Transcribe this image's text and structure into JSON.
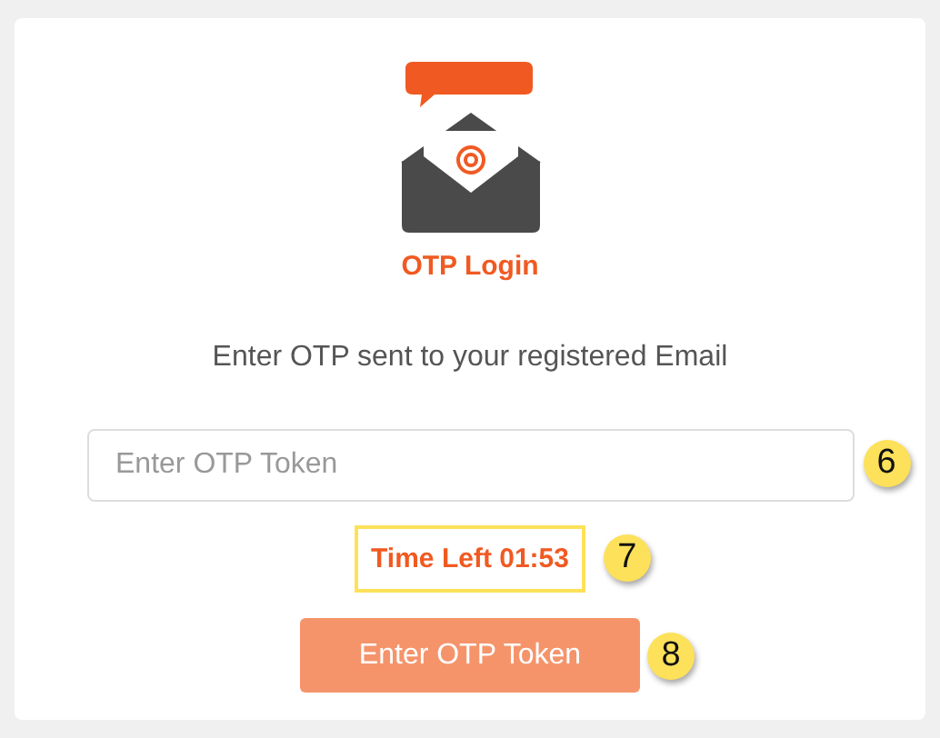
{
  "header": {
    "title": "OTP Login"
  },
  "instruction": "Enter OTP sent to your registered Email",
  "otp_field": {
    "placeholder": "Enter OTP Token",
    "callout": "6"
  },
  "timer": {
    "text": "Time Left 01:53",
    "callout": "7"
  },
  "submit_button": {
    "label": "Enter OTP Token",
    "callout": "8"
  }
}
